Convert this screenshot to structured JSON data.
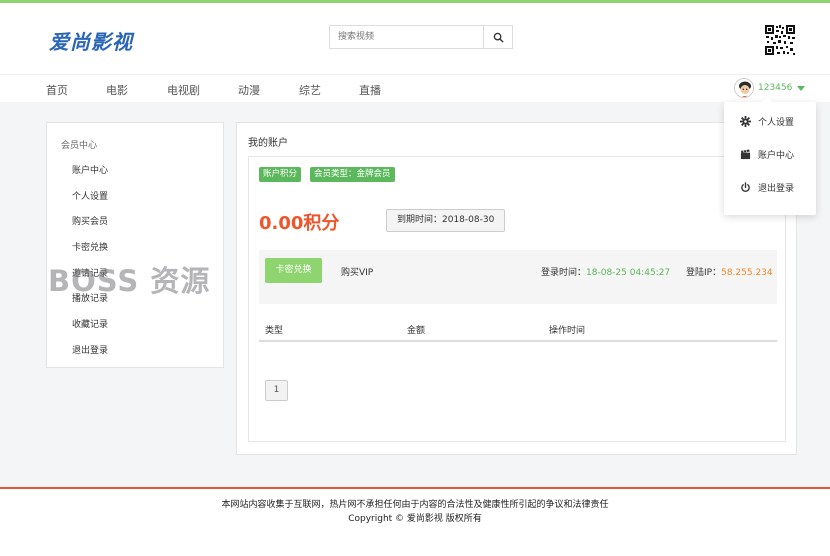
{
  "site": {
    "logo_text": "爱尚影视"
  },
  "search": {
    "placeholder": "搜索视频"
  },
  "nav": {
    "items": [
      "首页",
      "电影",
      "电视剧",
      "动漫",
      "综艺",
      "直播"
    ]
  },
  "user": {
    "name": "123456"
  },
  "sidebar": {
    "title": "会员中心",
    "items": [
      "账户中心",
      "个人设置",
      "购买会员",
      "卡密兑换",
      "邀请记录",
      "播放记录",
      "收藏记录",
      "退出登录"
    ]
  },
  "watermark": "BOSS 资源",
  "account": {
    "title": "我的账户",
    "tags": [
      "账户积分",
      "会员类型：金牌会员"
    ],
    "points": "0.00积分",
    "expire": "到期时间：2018-08-30",
    "redeem_button": "卡密兑换",
    "buy_vip": "购买VIP",
    "login_time_label": "登录时间：",
    "login_time": "18-08-25 04:45:27",
    "login_ip_label": "登陆IP：",
    "login_ip": "58.255.234",
    "table_headers": [
      "类型",
      "金额",
      "操作时间"
    ],
    "page": "1"
  },
  "dropdown": {
    "items": [
      "个人设置",
      "账户中心",
      "退出登录"
    ]
  },
  "footer": {
    "line1": "本网站内容收集于互联网，热片网不承担任何由于内容的合法性及健康性所引起的争议和法律责任",
    "line2": "Copyright ©  爱尚影视 版权所有"
  },
  "colors": {
    "accent_green": "#5cb85c",
    "button_green": "#8ed46f",
    "points_red": "#f0542b",
    "ip_orange": "#f0882b",
    "footer_red": "#e8543a",
    "logo_blue": "#2a66b7"
  }
}
